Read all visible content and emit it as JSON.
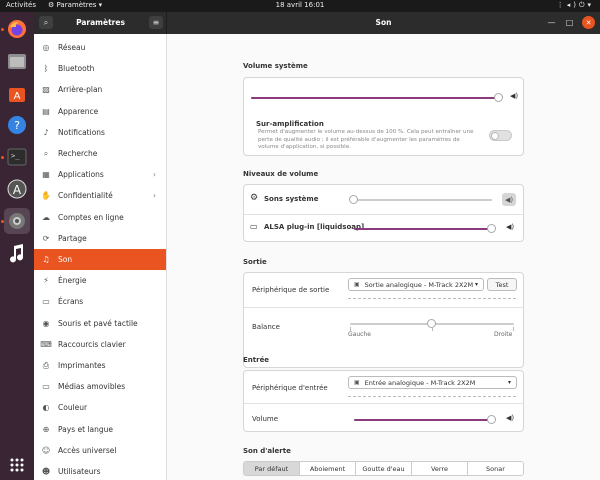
{
  "topbar": {
    "activities": "Activités",
    "app_menu": "Paramètres",
    "clock": "18 avril  16:01"
  },
  "dock": {
    "apps": [
      "firefox-icon",
      "files-icon",
      "software-store-icon",
      "help-icon",
      "terminal-icon",
      "software-updater-icon",
      "settings-icon",
      "music-icon"
    ],
    "grid_icon": "app-grid-icon"
  },
  "header": {
    "left_title": "Paramètres",
    "right_title": "Son"
  },
  "sidebar": {
    "items": [
      {
        "label": "Réseau",
        "icon": "network-icon"
      },
      {
        "label": "Bluetooth",
        "icon": "bluetooth-icon"
      },
      {
        "label": "Arrière-plan",
        "icon": "background-icon"
      },
      {
        "label": "Apparence",
        "icon": "appearance-icon"
      },
      {
        "label": "Notifications",
        "icon": "bell-icon"
      },
      {
        "label": "Recherche",
        "icon": "search-icon"
      },
      {
        "label": "Applications",
        "icon": "applications-icon",
        "arrow": "›"
      },
      {
        "label": "Confidentialité",
        "icon": "privacy-icon",
        "arrow": "›"
      },
      {
        "label": "Comptes en ligne",
        "icon": "cloud-icon"
      },
      {
        "label": "Partage",
        "icon": "share-icon"
      },
      {
        "label": "Son",
        "icon": "music-note-icon",
        "selected": true
      },
      {
        "label": "Énergie",
        "icon": "power-icon"
      },
      {
        "label": "Écrans",
        "icon": "display-icon"
      },
      {
        "label": "Souris et pavé tactile",
        "icon": "mouse-icon"
      },
      {
        "label": "Raccourcis clavier",
        "icon": "keyboard-icon"
      },
      {
        "label": "Imprimantes",
        "icon": "printer-icon"
      },
      {
        "label": "Médias amovibles",
        "icon": "removable-media-icon"
      },
      {
        "label": "Couleur",
        "icon": "color-icon"
      },
      {
        "label": "Pays et langue",
        "icon": "globe-icon"
      },
      {
        "label": "Accès universel",
        "icon": "accessibility-icon"
      },
      {
        "label": "Utilisateurs",
        "icon": "users-icon"
      }
    ]
  },
  "volume_system": {
    "title": "Volume système",
    "level": 1.0,
    "overamp_label": "Sur-amplification",
    "overamp_desc": "Permet d'augmenter le volume au-dessus de 100 %. Cela peut entraîner une perte de qualité audio ; il est préférable d'augmenter les paramètres de volume d'application, si possible.",
    "overamp_enabled": false
  },
  "levels": {
    "title": "Niveaux de volume",
    "system_sounds_label": "Sons système",
    "system_sounds_level": 0.0,
    "alsa_label": "ALSA plug-in [liquidsoap]",
    "alsa_level": 1.0
  },
  "output": {
    "title": "Sortie",
    "device_label": "Périphérique de sortie",
    "device_value": "Sortie analogique - M-Track 2X2M",
    "test_label": "Test",
    "balance_label": "Balance",
    "balance_level": 0.5,
    "left_label": "Gauche",
    "right_label": "Droite"
  },
  "input": {
    "title": "Entrée",
    "device_label": "Périphérique d'entrée",
    "device_value": "Entrée analogique - M-Track 2X2M",
    "volume_label": "Volume",
    "volume_level": 1.0
  },
  "alert": {
    "title": "Son d'alerte",
    "options": [
      "Par défaut",
      "Aboiement",
      "Goutte d'eau",
      "Verre",
      "Sonar"
    ],
    "selected_index": 0
  },
  "colors": {
    "accent": "#e95420",
    "slider_fill": "#8b3a7e",
    "headerbar": "#2c2c2c",
    "dock": "#3a2535"
  }
}
